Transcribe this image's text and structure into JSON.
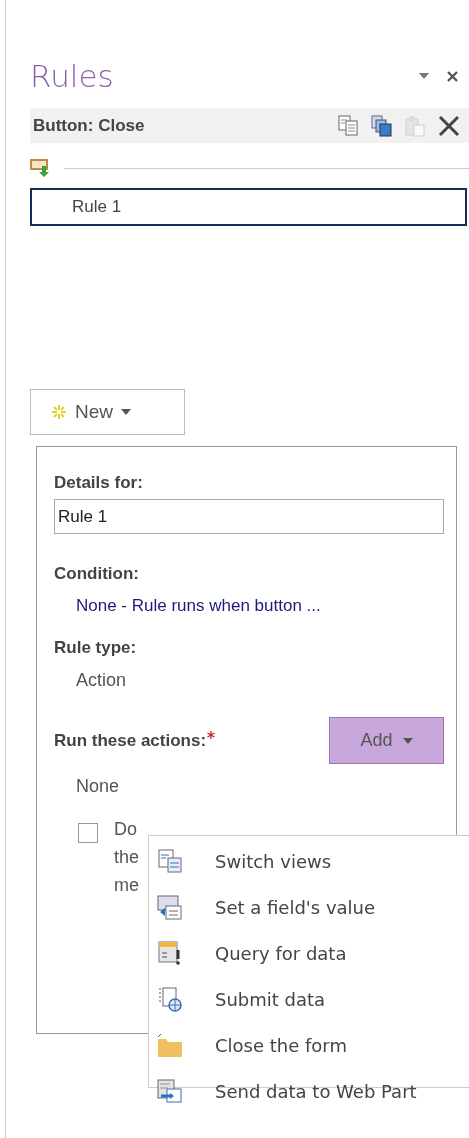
{
  "pane": {
    "title": "Rules",
    "controls": [
      {
        "kind": "dropdown"
      },
      {
        "kind": "close"
      }
    ]
  },
  "header": {
    "label": "Button: Close",
    "tools": [
      {
        "kind": "copy",
        "disabled": false
      },
      {
        "kind": "copy-all",
        "disabled": false
      },
      {
        "kind": "paste",
        "disabled": true
      },
      {
        "kind": "delete",
        "disabled": false
      }
    ]
  },
  "rules": [
    {
      "label": "Rule 1",
      "selected": true
    }
  ],
  "new_button": {
    "label": "New"
  },
  "details": {
    "name_label": "Details for:",
    "name_value": "Rule 1",
    "condition_label": "Condition:",
    "condition": "None - Rule runs when button ...",
    "rule_type_label": "Rule type:",
    "rule_type": "Action",
    "actions_label": "Run these actions:",
    "required": true,
    "add_button": "Add",
    "actions_value": "None",
    "checkbox": {
      "checked": false,
      "lines": [
        "Do",
        "the",
        "me"
      ]
    }
  },
  "add_menu": {
    "items": [
      {
        "label": "Switch views",
        "kind": "switch-views"
      },
      {
        "label": "Set a field's value",
        "kind": "set-value"
      },
      {
        "label": "Query for data",
        "kind": "query"
      },
      {
        "label": "Submit data",
        "kind": "submit"
      },
      {
        "label": "Close the form",
        "kind": "close-form"
      },
      {
        "label": "Send data to Web Part",
        "kind": "send-web-part"
      }
    ]
  }
}
